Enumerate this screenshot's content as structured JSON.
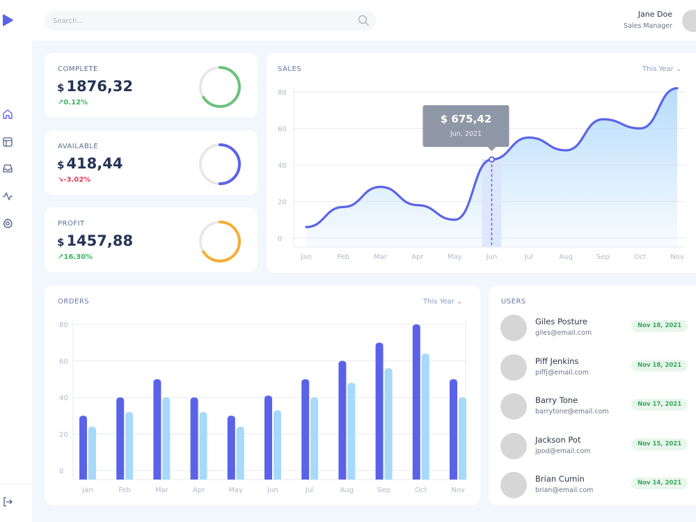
{
  "brand": {
    "logo_icon": "play-icon",
    "color": "#5a63e8"
  },
  "sidebar": {
    "items": [
      {
        "name": "home",
        "icon": "home-icon"
      },
      {
        "name": "layout",
        "icon": "layout-icon"
      },
      {
        "name": "inbox",
        "icon": "inbox-icon"
      },
      {
        "name": "activity",
        "icon": "activity-icon"
      },
      {
        "name": "settings",
        "icon": "gear-icon"
      }
    ],
    "logout_icon": "logout-icon"
  },
  "search": {
    "placeholder": "Search...",
    "value": ""
  },
  "user": {
    "name": "Jane Doe",
    "role": "Sales Manager"
  },
  "stats": {
    "complete": {
      "label": "COMPLETE",
      "currency": "$",
      "value": "1876,32",
      "change_arrow": "↗",
      "change": "0.12%",
      "trend": "up",
      "progress": 0.66,
      "color": "#6cc27a"
    },
    "available": {
      "label": "AVAILABLE",
      "currency": "$",
      "value": "418,44",
      "change_arrow": "↘",
      "change": "-3.02%",
      "trend": "down",
      "progress": 0.5,
      "color": "#5a63e8"
    },
    "profit": {
      "label": "PROFIT",
      "currency": "$",
      "value": "1457,88",
      "change_arrow": "↗",
      "change": "16.30%",
      "trend": "up",
      "progress": 0.66,
      "color": "#f4ae32"
    }
  },
  "sales": {
    "title": "SALES",
    "period": "This Year",
    "tooltip": {
      "value": "$ 675,42",
      "date": "Jun, 2021"
    }
  },
  "orders": {
    "title": "ORDERS",
    "period": "This Year"
  },
  "users_card": {
    "title": "USERS",
    "rows": [
      {
        "name": "Giles Posture",
        "email": "giles@email.com",
        "date": "Nov 18, 2021"
      },
      {
        "name": "Piff Jenkins",
        "email": "piffj@email.com",
        "date": "Nov 18, 2021"
      },
      {
        "name": "Barry Tone",
        "email": "barrytone@email.com",
        "date": "Nov 17, 2021"
      },
      {
        "name": "Jackson Pot",
        "email": "jpod@email.com",
        "date": "Nov 15, 2021"
      },
      {
        "name": "Brian Cumin",
        "email": "brian@email.com",
        "date": "Nov 14, 2021"
      }
    ]
  },
  "chart_data": [
    {
      "type": "area",
      "title": "SALES",
      "categories": [
        "Jan",
        "Feb",
        "Mar",
        "Apr",
        "May",
        "Jun",
        "Jul",
        "Aug",
        "Sep",
        "Oct",
        "Nov"
      ],
      "values": [
        6,
        17,
        28,
        18,
        10,
        43,
        55,
        48,
        65,
        60,
        82
      ],
      "ylim": [
        0,
        80
      ],
      "yticks": [
        0,
        20,
        40,
        60,
        80
      ],
      "highlight": {
        "category": "Jun",
        "x": 5.0,
        "y": 43
      },
      "grid": true,
      "colors": {
        "line": "#5a63e8",
        "fill": "#b3dafc"
      }
    },
    {
      "type": "bar",
      "title": "ORDERS",
      "categories": [
        "Jan",
        "Feb",
        "Mar",
        "Apr",
        "May",
        "Jun",
        "Jul",
        "Aug",
        "Sep",
        "Oct",
        "Nov"
      ],
      "series": [
        {
          "values": [
            30,
            40,
            50,
            40,
            30,
            41,
            50,
            60,
            70,
            80,
            50
          ],
          "color": "#5a63e8"
        },
        {
          "values": [
            24,
            32,
            40,
            32,
            24,
            33,
            40,
            48,
            56,
            64,
            40
          ],
          "color": "#a7d9fb"
        }
      ],
      "ylim": [
        0,
        80
      ],
      "yticks": [
        0,
        20,
        40,
        60,
        80
      ],
      "grid": true
    }
  ]
}
